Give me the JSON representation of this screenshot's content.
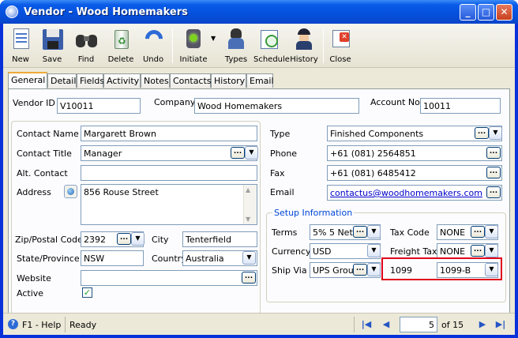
{
  "window": {
    "title": "Vendor - Wood Homemakers"
  },
  "toolbar": {
    "new": "New",
    "save": "Save",
    "find": "Find",
    "delete": "Delete",
    "undo": "Undo",
    "initiate": "Initiate",
    "types": "Types",
    "schedule": "Schedule",
    "history": "History",
    "close": "Close"
  },
  "tabs": [
    "General",
    "Detail",
    "Fields",
    "Activity",
    "Notes",
    "Contacts",
    "History",
    "Email"
  ],
  "header": {
    "vendor_id_label": "Vendor ID",
    "vendor_id": "V10011",
    "company_label": "Company",
    "company": "Wood Homemakers",
    "account_no_label": "Account No",
    "account_no": "10011"
  },
  "contact": {
    "name_label": "Contact Name",
    "name": "Margarett Brown",
    "title_label": "Contact Title",
    "title": "Manager",
    "alt_label": "Alt. Contact",
    "alt": "",
    "address_label": "Address",
    "address": "856 Rouse Street",
    "zip_label": "Zip/Postal Code",
    "zip": "2392",
    "city_label": "City",
    "city": "Tenterfield",
    "state_label": "State/Province",
    "state": "NSW",
    "country_label": "Country",
    "country": "Australia",
    "website_label": "Website",
    "website": "",
    "active_label": "Active",
    "active_check": "✓"
  },
  "right": {
    "type_label": "Type",
    "type": "Finished Components",
    "phone_label": "Phone",
    "phone": "+61 (081) 2564851",
    "fax_label": "Fax",
    "fax": "+61 (081) 6485412",
    "email_label": "Email",
    "email": "contactus@woodhomemakers.com"
  },
  "setup": {
    "title": "Setup Information",
    "terms_label": "Terms",
    "terms": "5% 5 Net",
    "taxcode_label": "Tax Code",
    "taxcode": "NONE",
    "currency_label": "Currency",
    "currency": "USD",
    "freight_label": "Freight Tax",
    "freight": "NONE",
    "shipvia_label": "Ship Via",
    "shipvia": "UPS Grou",
    "form1099_label": "1099",
    "form1099": "1099-B"
  },
  "status": {
    "help": "F1 - Help",
    "state": "Ready",
    "record": "5",
    "of": "of 15"
  },
  "colors": {
    "titlebar": "#0a5ce8",
    "highlight_box": "#e0001a",
    "active_tab_accent": "#f1a93a"
  },
  "icons": {
    "dots": "...",
    "dropdown": "▼"
  }
}
